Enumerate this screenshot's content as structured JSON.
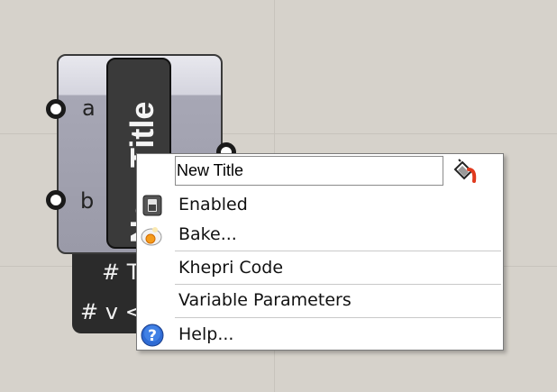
{
  "component": {
    "inputs": [
      {
        "label": "a"
      },
      {
        "label": "b"
      }
    ],
    "title": "New Title",
    "footer": {
      "line1": "# T",
      "line2": "# v <"
    }
  },
  "context_menu": {
    "name_field_value": "New Title",
    "color_icon": "paint-bucket-icon",
    "items": [
      {
        "label": "Enabled",
        "icon": "enabled-icon"
      },
      {
        "label": "Bake...",
        "icon": "bake-icon"
      },
      {
        "label": "Khepri Code"
      },
      {
        "label": "Variable Parameters"
      },
      {
        "label": "Help...",
        "icon": "help-icon"
      }
    ]
  },
  "colors": {
    "canvas": "#d6d2cb",
    "component_dark": "#3a3a3a",
    "menu_background": "#ffffff"
  }
}
